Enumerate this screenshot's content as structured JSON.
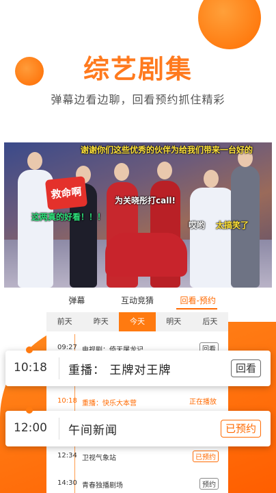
{
  "hero": {
    "title": "综艺剧集",
    "subtitle": "弹幕边看边聊，回看预约抓住精彩"
  },
  "video": {
    "logo_text": "救命啊",
    "danmaku": [
      {
        "text": "谢谢你们这些优秀的伙伴为给我们带来一台好的",
        "color": "#ffe23a"
      },
      {
        "text": "为关晓彤打call!",
        "color": "#ffffff"
      },
      {
        "text": "这两真的好看！！！",
        "color": "#2ee07a"
      },
      {
        "text": "哎哟",
        "color": "#ffffff"
      },
      {
        "text": "太搞笑了",
        "color": "#ffe23a"
      }
    ]
  },
  "tabs": [
    "弹幕",
    "互动竞猜",
    "回看-预约"
  ],
  "active_tab": "回看-预约",
  "days": [
    "前天",
    "昨天",
    "今天",
    "明天",
    "后天"
  ],
  "active_day": "今天",
  "programs": [
    {
      "time": "09:27",
      "name": "电视剧：倚天屠龙记",
      "status": "回看",
      "style": "normal"
    },
    {
      "time": "10:18",
      "name": "重播：快乐大本营",
      "status": "正在播放",
      "style": "live"
    },
    {
      "time": "12:34",
      "name": "卫视气象站",
      "status": "已预约",
      "style": "booked"
    },
    {
      "time": "14:30",
      "name": "青春独播剧场",
      "status": "预约",
      "style": "normal"
    }
  ],
  "cards": [
    {
      "time": "10:18",
      "label": "重播：  王牌对王牌",
      "button": "回看"
    },
    {
      "time": "12:00",
      "label": "午间新闻",
      "button": "已预约"
    }
  ],
  "colors": {
    "accent": "#ff7a1e",
    "live": "#ff6a00"
  }
}
